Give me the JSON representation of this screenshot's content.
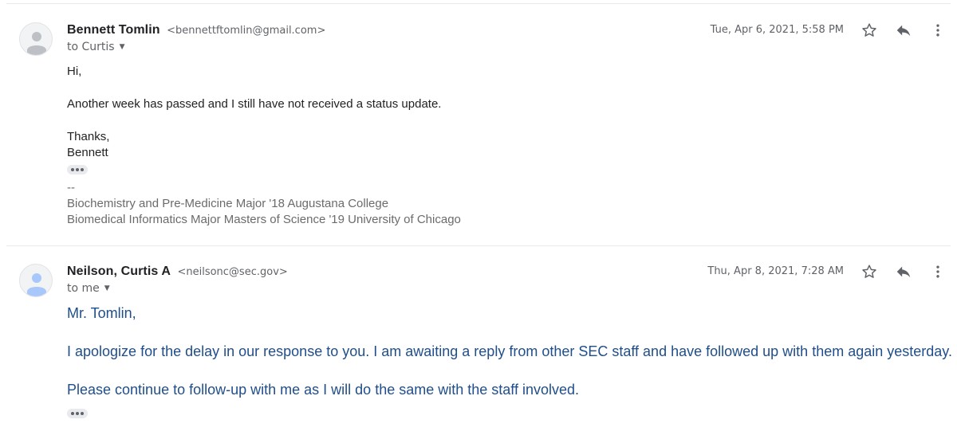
{
  "messages": [
    {
      "sender_name": "Bennett Tomlin",
      "sender_email": "<bennettftomlin@gmail.com>",
      "to_label": "to Curtis",
      "timestamp": "Tue, Apr 6, 2021, 5:58 PM",
      "greeting": "Hi,",
      "line1": "Another week has passed and I still have not received a status update.",
      "closing": "Thanks,",
      "signoff": "Bennett",
      "sig_dash": "--",
      "sig_line1": "Biochemistry and Pre-Medicine Major '18 Augustana College",
      "sig_line2": "Biomedical Informatics Major Masters of Science '19 University of Chicago",
      "avatar_color": "#bdc1c6"
    },
    {
      "sender_name": "Neilson, Curtis A",
      "sender_email": "<neilsonc@sec.gov>",
      "to_label": "to me",
      "timestamp": "Thu, Apr 8, 2021, 7:28 AM",
      "greeting": "Mr. Tomlin,",
      "line1": "I apologize for the delay in our response to you.  I am awaiting a reply from other SEC staff and have followed up with them again yesterday.",
      "line2": "Please continue to follow-up with me as I will do the same with the staff involved.",
      "avatar_color": "#a8c7fa",
      "body_color": "#1f4e8c"
    }
  ],
  "icons": {
    "star": "star-icon",
    "reply": "reply-icon",
    "more": "more-vert-icon",
    "caret": "caret-down-icon",
    "ellipsis": "show-trimmed-content-icon"
  },
  "colors": {
    "meta_gray": "#5f6368",
    "divider": "#e8eaed"
  }
}
